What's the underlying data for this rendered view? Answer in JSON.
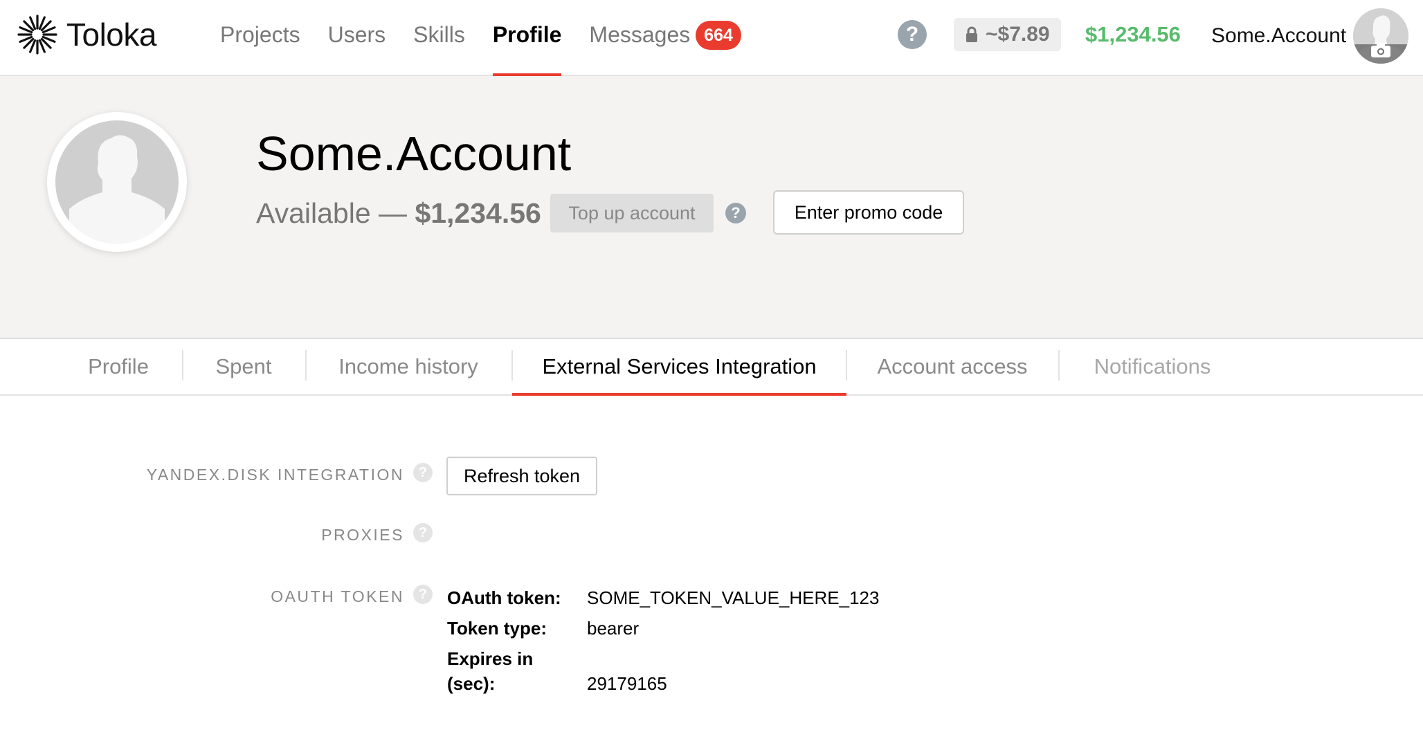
{
  "app": {
    "logo_text": "Toloka"
  },
  "nav": {
    "items": [
      {
        "label": "Projects"
      },
      {
        "label": "Users"
      },
      {
        "label": "Skills"
      },
      {
        "label": "Profile",
        "active": true
      },
      {
        "label": "Messages",
        "badge": "664"
      }
    ]
  },
  "topbar": {
    "help_glyph": "?",
    "locked_amount": "~$7.89",
    "balance": "$1,234.56",
    "account_name": "Some.Account"
  },
  "profile": {
    "name": "Some.Account",
    "available_prefix": "Available — ",
    "available_amount": "$1,234.56",
    "topup_label": "Top up account",
    "help_glyph": "?",
    "promo_label": "Enter promo code"
  },
  "tabs": {
    "items": [
      {
        "label": "Profile"
      },
      {
        "label": "Spent"
      },
      {
        "label": "Income history"
      },
      {
        "label": "External Services Integration",
        "active": true
      },
      {
        "label": "Account access"
      },
      {
        "label": "Notifications"
      }
    ]
  },
  "integration": {
    "yandex_disk": {
      "label": "YANDEX.DISK INTEGRATION",
      "button_label": "Refresh token"
    },
    "proxies": {
      "label": "PROXIES"
    },
    "oauth": {
      "label": "OAUTH TOKEN",
      "token_key": "OAuth token:",
      "token_value": "SOME_TOKEN_VALUE_HERE_123",
      "type_key": "Token type:",
      "type_value": "bearer",
      "expires_key_line1": "Expires in",
      "expires_key_line2": "(sec):",
      "expires_value": "29179165"
    },
    "help_glyph": "?"
  },
  "colors": {
    "accent_red": "#ea3c2e",
    "balance_green": "#57bb6b",
    "header_bg": "#f4f3f2"
  },
  "icons": {
    "logo": "toloka-starburst-icon",
    "lock": "lock-icon",
    "camera": "camera-icon",
    "avatar": "user-silhouette-icon"
  }
}
